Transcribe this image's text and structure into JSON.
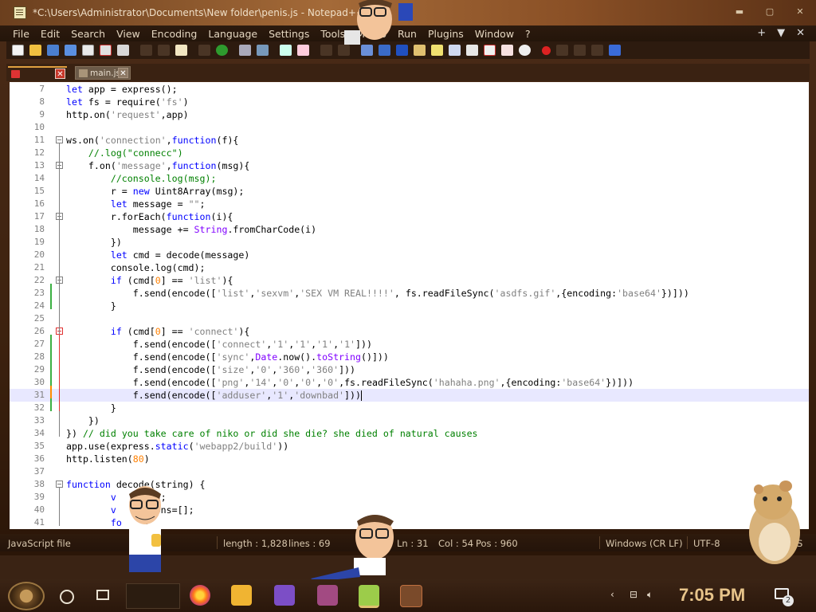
{
  "window": {
    "title": "*C:\\Users\\Administrator\\Documents\\New folder\\penis.js - Notepad++ [A",
    "controls": [
      "minimize-icon",
      "maximize-icon",
      "close-icon"
    ]
  },
  "menu": {
    "items": [
      "File",
      "Edit",
      "Search",
      "View",
      "Encoding",
      "Language",
      "Settings",
      "Tools",
      "Macro",
      "Run",
      "Plugins",
      "Window",
      "?"
    ],
    "right": [
      "+",
      "▼",
      "✕"
    ]
  },
  "tabs": [
    {
      "label": "",
      "active": true,
      "modified": true
    },
    {
      "label": "main.js",
      "active": false
    }
  ],
  "editor": {
    "lines": [
      {
        "n": "7",
        "html": "<span class=\"kw\">let</span> app = express();"
      },
      {
        "n": "8",
        "html": "<span class=\"kw\">let</span> fs = require(<span class=\"st\">'fs'</span>)"
      },
      {
        "n": "9",
        "html": "http.on(<span class=\"st\">'request'</span>,app)"
      },
      {
        "n": "10",
        "html": ""
      },
      {
        "n": "11",
        "html": "ws.on(<span class=\"st\">'connection'</span>,<span class=\"kw\">function</span>(f){"
      },
      {
        "n": "12",
        "html": "    <span class=\"cm\">//.log(\"connecc\")</span>"
      },
      {
        "n": "13",
        "html": "    f.on(<span class=\"st\">'message'</span>,<span class=\"kw\">function</span>(msg){"
      },
      {
        "n": "14",
        "html": "        <span class=\"cm\">//console.log(msg);</span>"
      },
      {
        "n": "15",
        "html": "        r = <span class=\"kw\">new</span> Uint8Array(msg);"
      },
      {
        "n": "16",
        "html": "        <span class=\"kw\">let</span> message = <span class=\"st\">\"\"</span>;"
      },
      {
        "n": "17",
        "html": "        r.forEach(<span class=\"kw\">function</span>(i){"
      },
      {
        "n": "18",
        "html": "            message += <span class=\"bl\">String</span>.fromCharCode(i)"
      },
      {
        "n": "19",
        "html": "        })"
      },
      {
        "n": "20",
        "html": "        <span class=\"kw\">let</span> cmd = decode(message)"
      },
      {
        "n": "21",
        "html": "        console.log(cmd);"
      },
      {
        "n": "22",
        "html": "        <span class=\"kw\">if</span> (cmd[<span class=\"nm\">0</span>] == <span class=\"st\">'list'</span>){"
      },
      {
        "n": "23",
        "html": "            f.send(encode([<span class=\"st\">'list'</span>,<span class=\"st\">'sexvm'</span>,<span class=\"st\">'SEX VM REAL!!!!'</span>, fs.readFileSync(<span class=\"st\">'asdfs.gif'</span>,{encoding:<span class=\"st\">'base64'</span>})]))"
      },
      {
        "n": "24",
        "html": "        }"
      },
      {
        "n": "25",
        "html": ""
      },
      {
        "n": "26",
        "html": "        <span class=\"kw\">if</span> (cmd[<span class=\"nm\">0</span>] == <span class=\"st\">'connect'</span>){"
      },
      {
        "n": "27",
        "html": "            f.send(encode([<span class=\"st\">'connect'</span>,<span class=\"st\">'1'</span>,<span class=\"st\">'1'</span>,<span class=\"st\">'1'</span>,<span class=\"st\">'1'</span>]))"
      },
      {
        "n": "28",
        "html": "            f.send(encode([<span class=\"st\">'sync'</span>,<span class=\"bl\">Date</span>.now().<span class=\"bl\">toString</span>()]))"
      },
      {
        "n": "29",
        "html": "            f.send(encode([<span class=\"st\">'size'</span>,<span class=\"st\">'0'</span>,<span class=\"st\">'360'</span>,<span class=\"st\">'360'</span>]))"
      },
      {
        "n": "30",
        "html": "            f.send(encode([<span class=\"st\">'png'</span>,<span class=\"st\">'14'</span>,<span class=\"st\">'0'</span>,<span class=\"st\">'0'</span>,<span class=\"st\">'0'</span>,fs.readFileSync(<span class=\"st\">'hahaha.png'</span>,{encoding:<span class=\"st\">'base64'</span>})]))"
      },
      {
        "n": "31",
        "html": "            f.send(encode([<span class=\"st\">'adduser'</span>,<span class=\"st\">'1'</span>,<span class=\"st\">'downbad'</span>]))<span class=\"caret\"></span>",
        "current": true
      },
      {
        "n": "32",
        "html": "        }"
      },
      {
        "n": "33",
        "html": "    })"
      },
      {
        "n": "34",
        "html": "}) <span class=\"cm\">// did you take care of niko or did she die? she died of natural causes</span>"
      },
      {
        "n": "35",
        "html": "app.use(express.<span class=\"kw\">static</span>(<span class=\"st\">'webapp2/build'</span>))"
      },
      {
        "n": "36",
        "html": "http.listen(<span class=\"nm\">80</span>)"
      },
      {
        "n": "37",
        "html": ""
      },
      {
        "n": "38",
        "html": "<span class=\"kw\">function</span> decode(string) {"
      },
      {
        "n": "39",
        "html": "        <span class=\"kw\">v</span>      <span class=\"nm\">-1</span>;"
      },
      {
        "n": "40",
        "html": "        <span class=\"kw\">v</span>     tions=[];"
      },
      {
        "n": "41",
        "html": "        <span class=\"kw\">fo</span>    {"
      }
    ]
  },
  "status": {
    "filetype": "JavaScript file",
    "length": "length : 1,828",
    "lines": "lines : 69",
    "ln": "Ln : 31",
    "col": "Col : 54",
    "pos": "Pos : 960",
    "eol": "Windows (CR LF)",
    "encoding": "UTF-8",
    "ins": "S"
  },
  "taskbar": {
    "clock": "7:05 PM",
    "notifications": "2"
  }
}
